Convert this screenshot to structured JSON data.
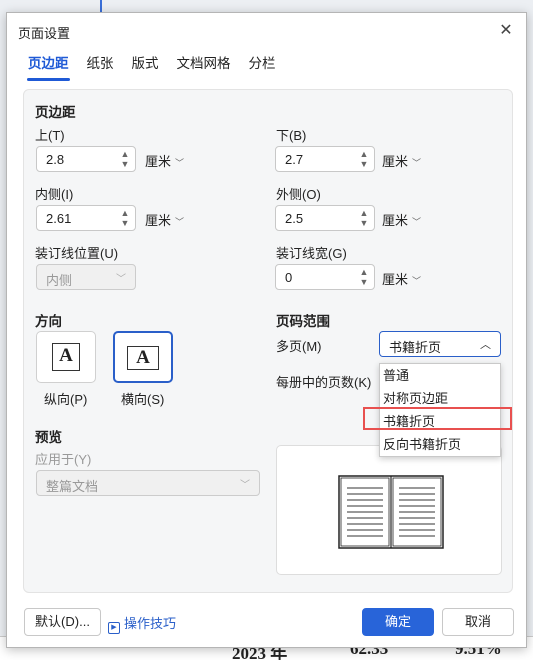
{
  "dialog": {
    "title": "页面设置",
    "close_glyph": "✕"
  },
  "tabs": [
    {
      "label": "页边距"
    },
    {
      "label": "纸张"
    },
    {
      "label": "版式"
    },
    {
      "label": "文档网格"
    },
    {
      "label": "分栏"
    }
  ],
  "margins": {
    "section_title": "页边距",
    "top": {
      "label": "上(T)",
      "value": "2.8",
      "unit": "厘米"
    },
    "bottom": {
      "label": "下(B)",
      "value": "2.7",
      "unit": "厘米"
    },
    "inside": {
      "label": "内侧(I)",
      "value": "2.61",
      "unit": "厘米"
    },
    "outside": {
      "label": "外侧(O)",
      "value": "2.5",
      "unit": "厘米"
    },
    "gutter_position": {
      "label": "装订线位置(U)",
      "value": "内侧"
    },
    "gutter_width": {
      "label": "装订线宽(G)",
      "value": "0",
      "unit": "厘米"
    }
  },
  "orientation": {
    "section_title": "方向",
    "portrait": {
      "glyph": "A",
      "label": "纵向(P)"
    },
    "landscape": {
      "glyph": "A",
      "label": "横向(S)"
    }
  },
  "page_range": {
    "section_title": "页码范围",
    "multiple_pages_label": "多页(M)",
    "multiple_pages_value": "书籍折页",
    "pages_per_booklet_label": "每册中的页数(K)",
    "options": [
      "普通",
      "对称页边距",
      "书籍折页",
      "反向书籍折页"
    ],
    "highlighted_option": "书籍折页"
  },
  "preview": {
    "section_title": "预览",
    "apply_to_label": "应用于(Y)",
    "apply_to_value": "整篇文档"
  },
  "footer": {
    "default_button": "默认(D)...",
    "tips_link": "操作技巧",
    "ok_button": "确定",
    "cancel_button": "取消"
  },
  "background": {
    "bottom_year": "2023 年",
    "bottom_value": "62.33",
    "bottom_percent": "9.51%"
  },
  "colors": {
    "accent": "#2864d9",
    "highlight_border": "#e8504f"
  }
}
